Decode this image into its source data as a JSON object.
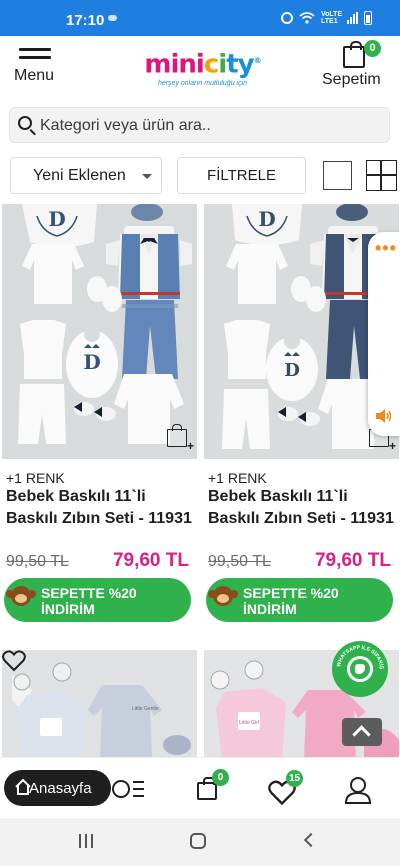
{
  "status_bar": {
    "time": "17:10",
    "network_label": "VoLTE LTE1"
  },
  "header": {
    "menu_label": "Menu",
    "logo": {
      "part1": "mini",
      "part2": "c",
      "part3": "i",
      "part4": "ty",
      "registered": "®",
      "tagline": "herşey onların mutluluğu için"
    },
    "cart_label": "Sepetim",
    "cart_count": "0"
  },
  "search": {
    "placeholder": "Kategori veya ürün ara.."
  },
  "controls": {
    "sort_label": "Yeni Eklenen",
    "filter_label": "FİLTRELE"
  },
  "products": [
    {
      "variant": "+1 RENK",
      "name": "Bebek Baskılı 11`li Baskılı Zıbın Seti - 11931",
      "old_price": "99,50 TL",
      "new_price": "79,60 TL",
      "promo": "SEPETTE %20 İNDİRİM"
    },
    {
      "variant": "+1 RENK",
      "name": "Bebek Baskılı 11`li Baskılı Zıbın Seti - 11931",
      "old_price": "99,50 TL",
      "new_price": "79,60 TL",
      "promo": "SEPETTE %20 İNDİRİM"
    }
  ],
  "floating": {
    "whatsapp_label": "WHATSAPP İLE SİPARİŞ"
  },
  "bottom_nav": {
    "home_label": "Anasayfa",
    "cart_badge": "0",
    "favorites_badge": "15"
  },
  "colors": {
    "status_bar": "#1e7fe0",
    "accent_green": "#2fb24c",
    "price_pink": "#d81f8a"
  }
}
